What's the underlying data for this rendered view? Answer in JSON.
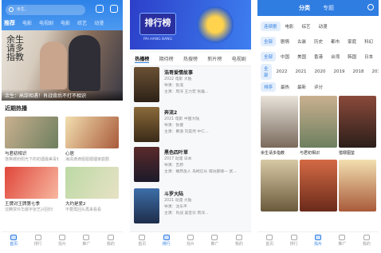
{
  "home": {
    "search_placeholder": "余生、",
    "tabs": [
      "推荐",
      "电影",
      "电视剧",
      "电影",
      "综艺",
      "动漫"
    ],
    "banner_caption": "余生：高甜相遇！肖战背后不打不相识",
    "banner_calligraphy": "余生请多指教",
    "section_title": "近期热播",
    "items": [
      {
        "title": "与君初相识",
        "sub": "落英缤纷阳光下的初遇最美青春"
      },
      {
        "title": "心居",
        "sub": "海清滴滴姐姐婚姻家庭剧"
      },
      {
        "title": "王牌对王牌第七季",
        "sub": "沈腾贾玲华晨宇张艺兴回归"
      },
      {
        "title": "大约是爱2",
        "sub": "不要再回头再来看看"
      }
    ]
  },
  "rank": {
    "banner_title": "排行榜",
    "banner_sub": "PAI HANG BANG",
    "tabs": [
      "热播榜",
      "期待榜",
      "热搜榜",
      "新片榜",
      "电视剧"
    ],
    "items": [
      {
        "title": "浩哥爱情故事",
        "meta": "2022  电影  大陆",
        "l1": "导演：张浩",
        "l2": "主演：周深 王力宏 张磊..."
      },
      {
        "title": "奔流2",
        "meta": "2021  电影  中国大陆",
        "l1": "导演：张健",
        "l2": "主演：黄渤 刘昊然 中仁..."
      },
      {
        "title": "黑色四叶草",
        "meta": "2017  动漫  日本",
        "l1": "导演：吉原",
        "l2": "主演：梶原岳人 岛崎信长 诹访部顺一 武..."
      },
      {
        "title": "斗罗大陆",
        "meta": "2021  动漫  大陆",
        "l1": "导演：沈乐平",
        "l2": "主演：肖战 吴宣仪 周深..."
      }
    ]
  },
  "category": {
    "tabs": [
      "分类",
      "专题"
    ],
    "rows": [
      [
        "连续剧",
        "电影",
        "综艺",
        "动漫"
      ],
      [
        "全部",
        "剧情",
        "古装",
        "历史",
        "都市",
        "家庭",
        "科幻"
      ],
      [
        "全部",
        "中国",
        "美国",
        "香港",
        "台湾",
        "韩国",
        "日本"
      ],
      [
        "全部",
        "2022",
        "2021",
        "2020",
        "2019",
        "2018",
        "2017"
      ],
      [
        "排序",
        "最热",
        "最新",
        "评分"
      ]
    ],
    "posters": [
      {
        "name": "余生请多指教"
      },
      {
        "name": "与君初相识"
      },
      {
        "name": "猎罪图鉴"
      },
      {
        "name": "庙宫"
      },
      {
        "name": "人世间"
      },
      {
        "name": "心居"
      }
    ]
  },
  "nav": [
    "首页",
    "排行",
    "找片",
    "推广",
    "我的"
  ],
  "colors": {
    "accent": "#2f7de1"
  }
}
